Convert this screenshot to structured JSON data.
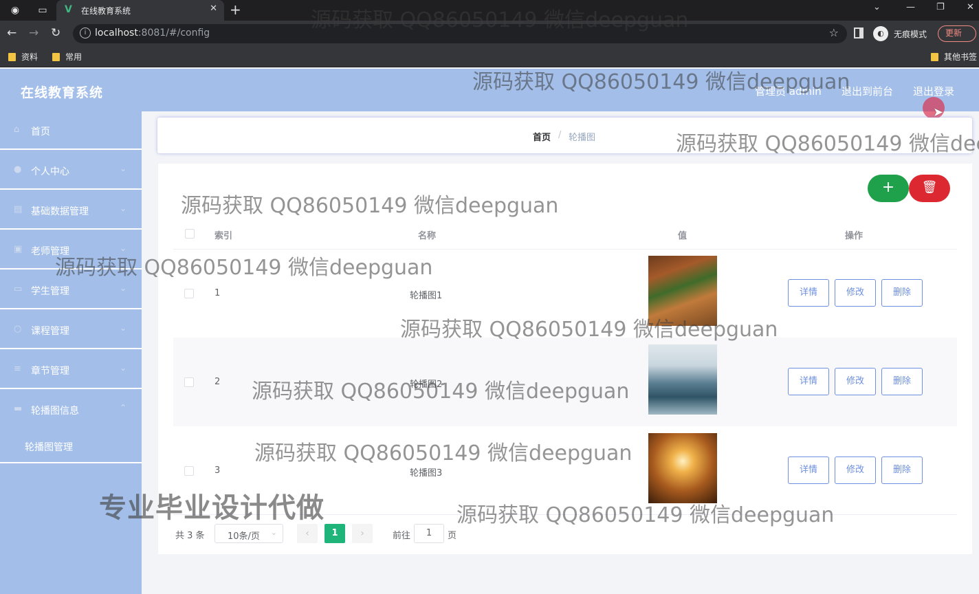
{
  "browser": {
    "tab_title": "在线教育系统",
    "url_host": "localhost",
    "url_rest": ":8081/#/config",
    "incognito_label": "无痕模式",
    "update_label": "更新",
    "bookmarks": [
      "资料",
      "常用"
    ],
    "other_bookmarks": "其他书签"
  },
  "header": {
    "app_title": "在线教育系统",
    "admin_label": "管理员 admin",
    "to_front": "退出到前台",
    "logout": "退出登录"
  },
  "sidebar": {
    "items": [
      {
        "label": "首页",
        "icon": "home-icon"
      },
      {
        "label": "个人中心",
        "icon": "user-icon"
      },
      {
        "label": "基础数据管理",
        "icon": "database-icon"
      },
      {
        "label": "老师管理",
        "icon": "teacher-icon"
      },
      {
        "label": "学生管理",
        "icon": "student-icon"
      },
      {
        "label": "课程管理",
        "icon": "course-icon"
      },
      {
        "label": "章节管理",
        "icon": "chapter-icon"
      },
      {
        "label": "轮播图信息",
        "icon": "carousel-icon"
      }
    ],
    "subitem": "轮播图管理"
  },
  "breadcrumb": {
    "home": "首页",
    "sep": "/",
    "current": "轮播图"
  },
  "table": {
    "headers": {
      "index": "索引",
      "name": "名称",
      "value": "值",
      "ops": "操作"
    },
    "rows": [
      {
        "index": "1",
        "name": "轮播图1"
      },
      {
        "index": "2",
        "name": "轮播图2"
      },
      {
        "index": "3",
        "name": "轮播图3"
      }
    ],
    "btn_detail": "详情",
    "btn_edit": "修改",
    "btn_delete": "删除"
  },
  "pager": {
    "total": "共 3 条",
    "page_size": "10条/页",
    "current": "1",
    "goto_prefix": "前往",
    "goto_value": "1",
    "goto_suffix": "页"
  },
  "watermark": {
    "text": "源码获取 QQ86050149 微信deepguan",
    "text_cut": "源码获取 QQ86050149 微信dee",
    "big": "专业毕业设计代做"
  },
  "colors": {
    "sidebar": "#a3bfe9",
    "add": "#1fa04a",
    "delete": "#dc2831",
    "pager_active": "#1fb57a",
    "op_button": "#6d8fe0"
  }
}
